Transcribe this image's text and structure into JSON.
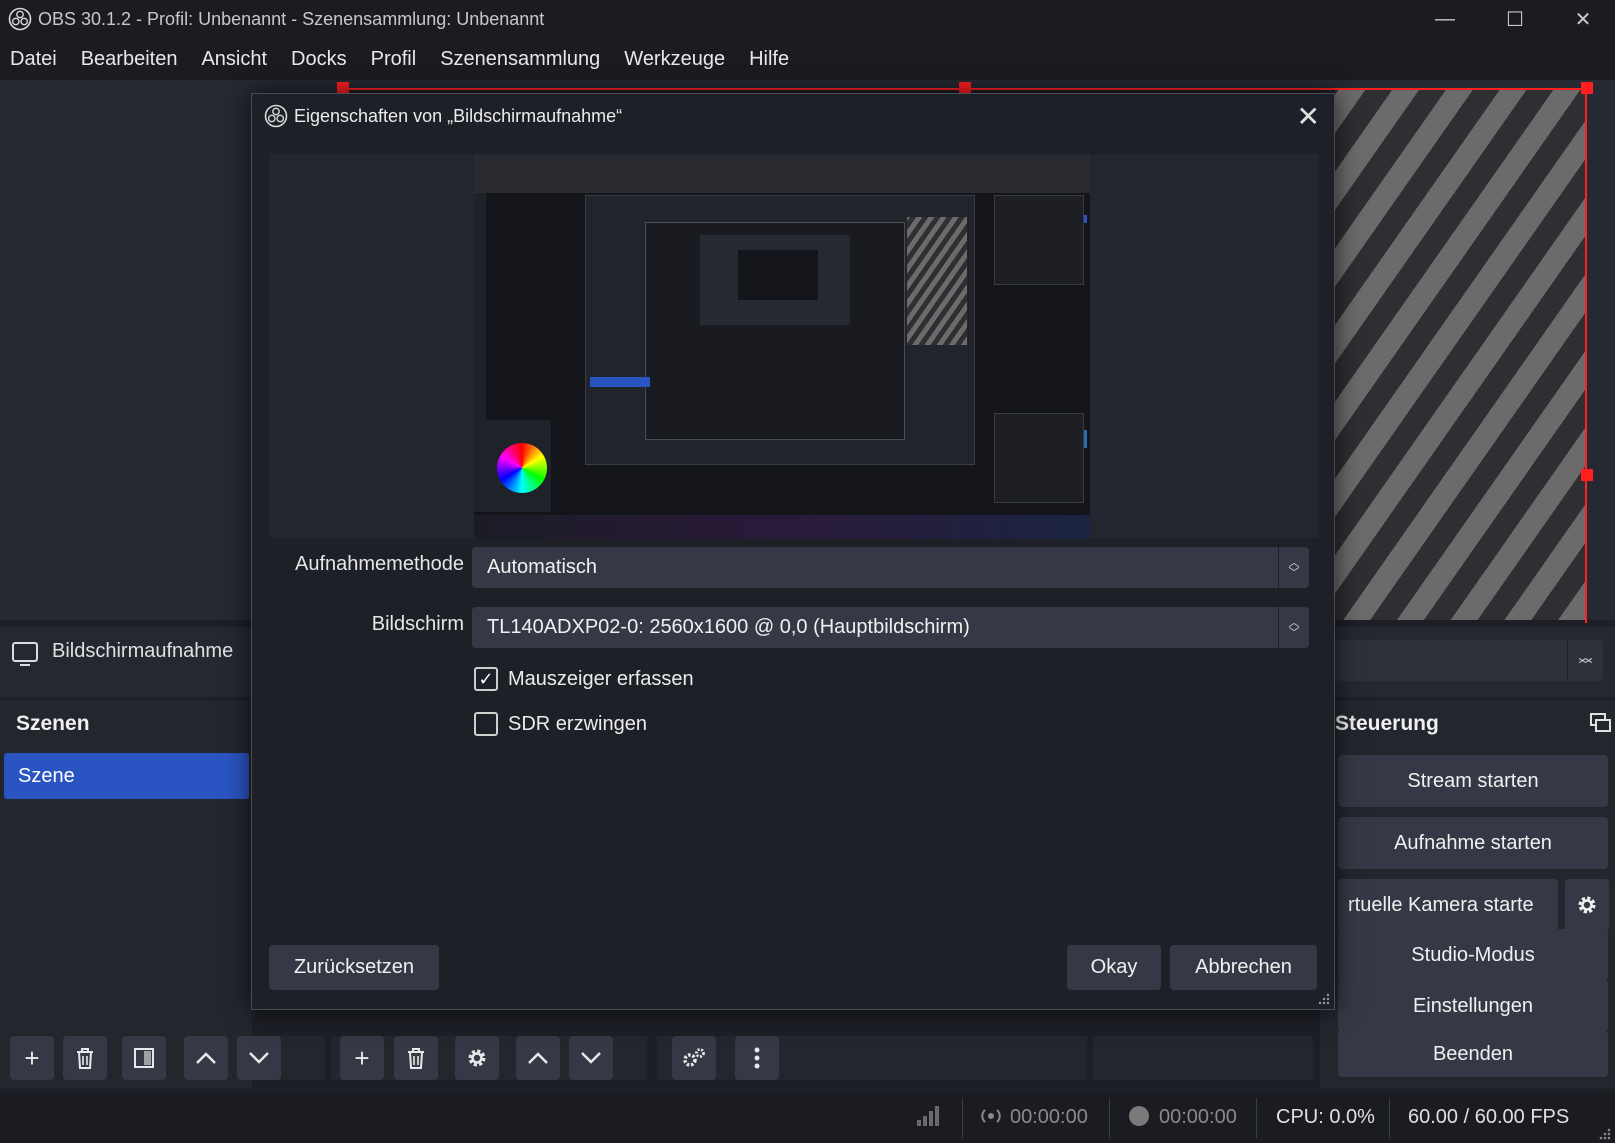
{
  "window": {
    "title": "OBS 30.1.2 - Profil: Unbenannt - Szenensammlung: Unbenannt",
    "minimize": "—",
    "maximize": "☐",
    "close": "✕"
  },
  "menu": [
    "Datei",
    "Bearbeiten",
    "Ansicht",
    "Docks",
    "Profil",
    "Szenensammlung",
    "Werkzeuge",
    "Hilfe"
  ],
  "source_bar": {
    "name": "Bildschirmaufnahme",
    "icon": "monitor-icon"
  },
  "scenes_dock": {
    "title": "Szenen",
    "items": [
      {
        "label": "Szene",
        "selected": true
      }
    ]
  },
  "controls_dock": {
    "title": "Steuerung",
    "buttons": {
      "stream": "Stream starten",
      "record": "Aufnahme starten",
      "virtual_cam": "rtuelle Kamera starte",
      "studio": "Studio-Modus",
      "settings": "Einstellungen",
      "exit": "Beenden"
    }
  },
  "status": {
    "stream_time": "00:00:00",
    "record_time": "00:00:00",
    "cpu": "CPU: 0.0%",
    "fps": "60.00 / 60.00 FPS"
  },
  "dialog": {
    "title": "Eigenschaften von „Bildschirmaufnahme“",
    "method_label": "Aufnahmemethode",
    "method_value": "Automatisch",
    "screen_label": "Bildschirm",
    "screen_value": "TL140ADXP02-0: 2560x1600 @ 0,0 (Hauptbildschirm)",
    "capture_cursor_label": "Mauszeiger erfassen",
    "capture_cursor_checked": true,
    "force_sdr_label": "SDR erzwingen",
    "force_sdr_checked": false,
    "reset_button": "Zurücksetzen",
    "ok_button": "Okay",
    "cancel_button": "Abbrechen"
  },
  "colors": {
    "accent": "#2a54c2",
    "selection_border": "#ff2020",
    "background": "#1d1f26",
    "button": "#363945"
  }
}
